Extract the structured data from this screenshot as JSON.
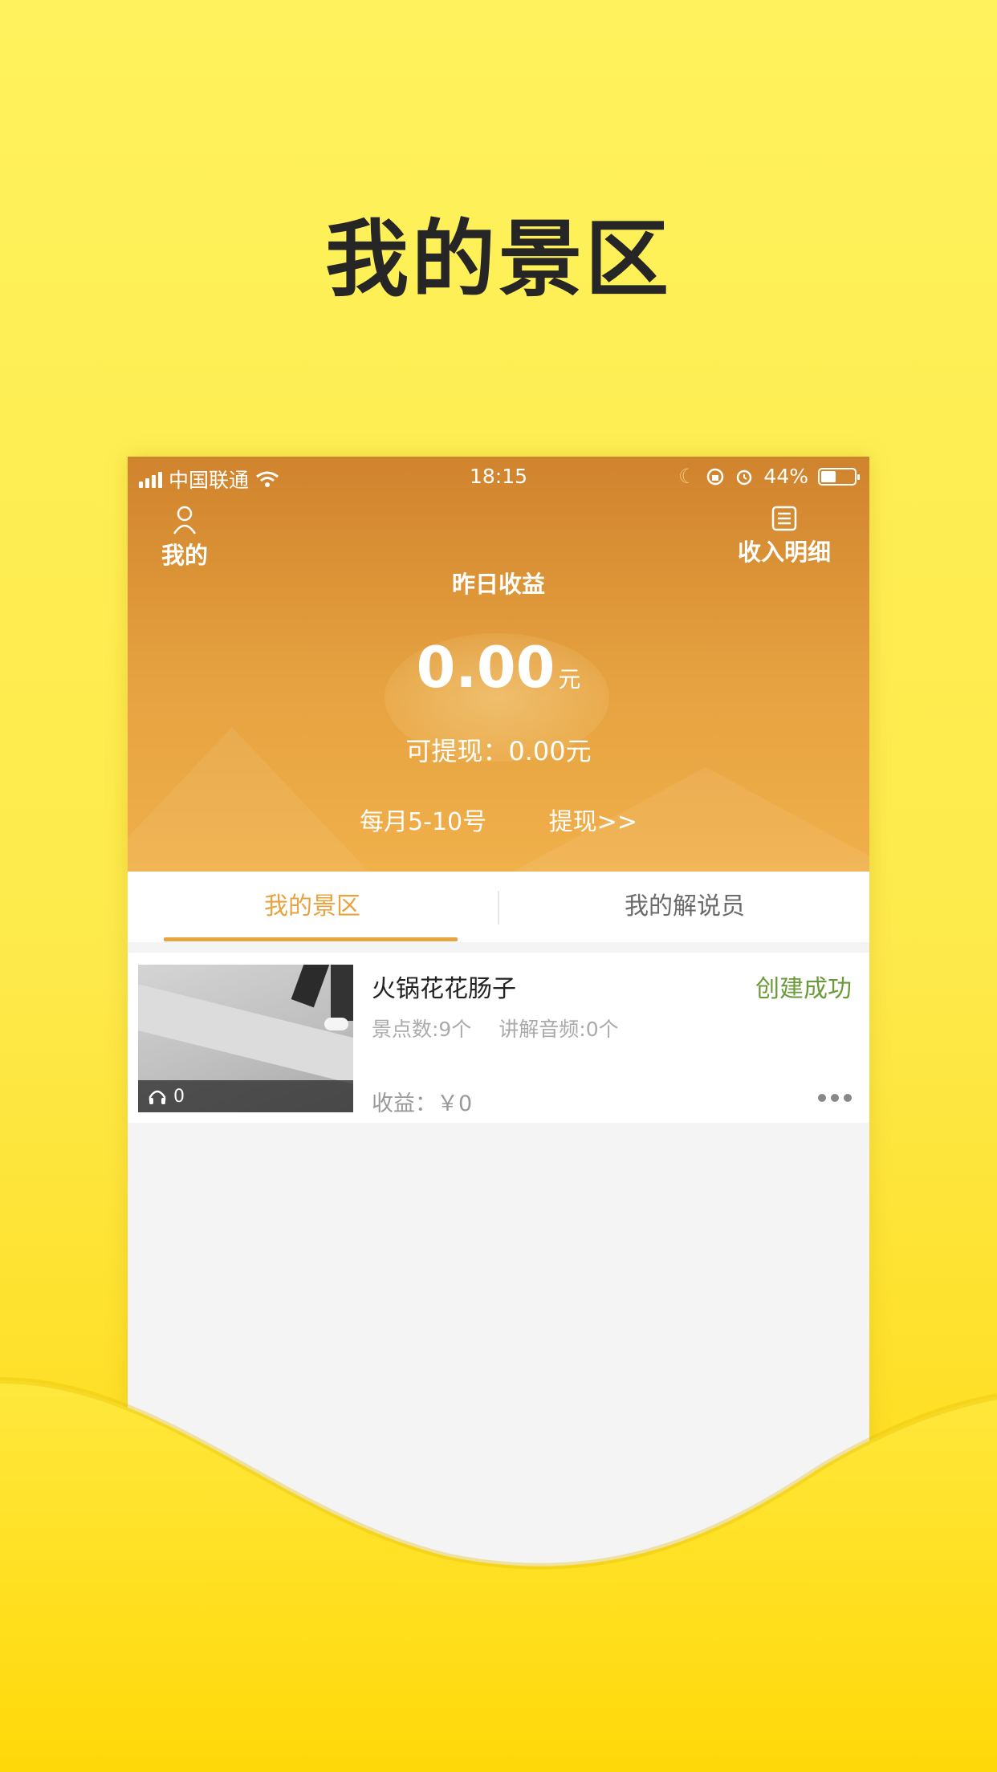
{
  "promo": {
    "title": "我的景区"
  },
  "status_bar": {
    "carrier": "中国联通",
    "time": "18:15",
    "battery": "44%"
  },
  "header": {
    "left_nav_label": "我的",
    "right_nav_label": "收入明细",
    "yesterday_label": "昨日收益",
    "amount": "0.00",
    "amount_unit": "元",
    "withdrawable": "可提现：0.00元",
    "withdraw_period": "每月5-10号",
    "withdraw_link": "提现>>"
  },
  "tabs": [
    {
      "label": "我的景区",
      "active": true
    },
    {
      "label": "我的解说员",
      "active": false
    }
  ],
  "scenic_list": [
    {
      "title": "火锅花花肠子",
      "status": "创建成功",
      "spots": "景点数:9个",
      "audio": "讲解音频:0个",
      "income": "收益：￥0",
      "listen_count": "0"
    }
  ],
  "colors": {
    "accent": "#e8a33f",
    "status_success": "#6b9a3a",
    "header_top": "#d0832d",
    "header_bottom": "#f0b04a"
  }
}
